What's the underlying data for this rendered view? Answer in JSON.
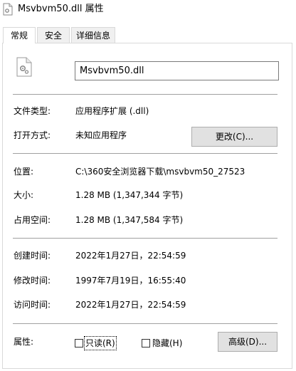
{
  "window": {
    "title": "Msvbvm50.dll 属性",
    "icon": "dll-file-icon"
  },
  "tabs": [
    "常规",
    "安全",
    "详细信息"
  ],
  "general": {
    "file_name": "Msvbvm50.dll",
    "file_icon": "dll-gear-file-icon",
    "type_label": "文件类型:",
    "type_value": "应用程序扩展 (.dll)",
    "open_with_label": "打开方式:",
    "open_with_value": "未知应用程序",
    "change_button": "更改(C)...",
    "location_label": "位置:",
    "location_value": "C:\\360安全浏览器下载\\msvbvm50_27523",
    "size_label": "大小:",
    "size_value": "1.28 MB (1,347,344 字节)",
    "size_on_disk_label": "占用空间:",
    "size_on_disk_value": "1.28 MB (1,347,584 字节)",
    "created_label": "创建时间:",
    "created_value": "2022年1月27日，22:54:59",
    "modified_label": "修改时间:",
    "modified_value": "1997年7月19日，16:55:40",
    "accessed_label": "访问时间:",
    "accessed_value": "2022年1月27日，22:54:59",
    "attributes_label": "属性:",
    "readonly_label": "只读(R)",
    "readonly_checked": false,
    "hidden_label": "隐藏(H)",
    "hidden_checked": false,
    "advanced_button": "高级(D)..."
  }
}
